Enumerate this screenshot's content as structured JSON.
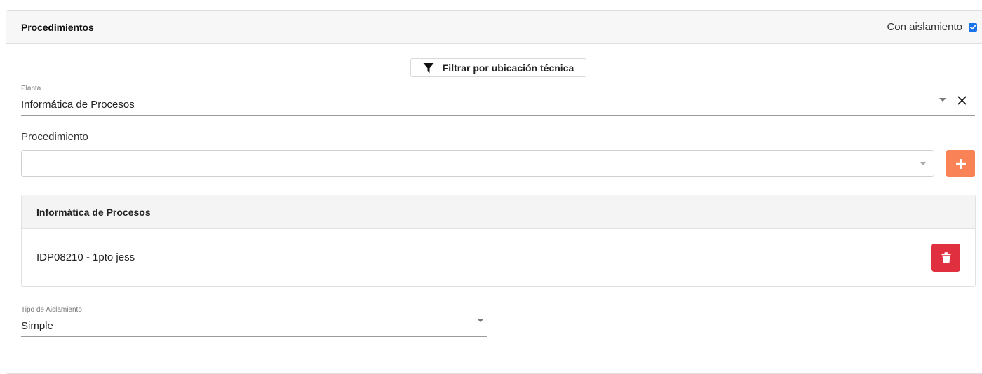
{
  "panel": {
    "title": "Procedimientos",
    "isolation_label": "Con aislamiento",
    "isolation_checked": true
  },
  "filter_button": {
    "label": "Filtrar por ubicación técnica",
    "icon": "filter-icon"
  },
  "planta": {
    "label": "Planta",
    "value": "Informática de Procesos"
  },
  "procedimiento": {
    "label": "Procedimiento",
    "value": ""
  },
  "group": {
    "title": "Informática de Procesos",
    "items": [
      {
        "label": "IDP08210 - 1pto jess"
      }
    ]
  },
  "tipo_aislamiento": {
    "label": "Tipo de Aislamiento",
    "value": "Simple"
  },
  "colors": {
    "checkbox": "#1a73e8",
    "add_button": "#f98356",
    "delete_button": "#e0303f"
  }
}
